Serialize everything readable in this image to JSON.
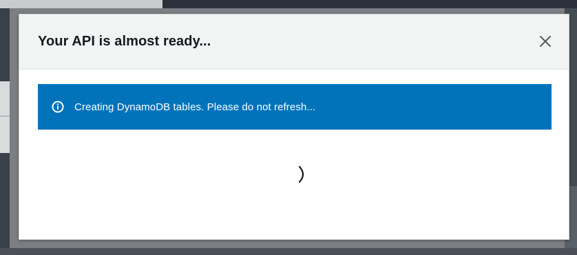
{
  "modal": {
    "title": "Your API is almost ready...",
    "close_icon": "close-icon",
    "flash": {
      "icon": "info-icon",
      "message": "Creating DynamoDB tables. Please do not refresh...",
      "background": "#0073bb"
    },
    "spinner_icon": "spinner-icon"
  },
  "colors": {
    "header_bg": "#f2f3f3",
    "title_text": "#16191f",
    "flash_bg": "#0073bb",
    "overlay": "#7b7e82"
  }
}
